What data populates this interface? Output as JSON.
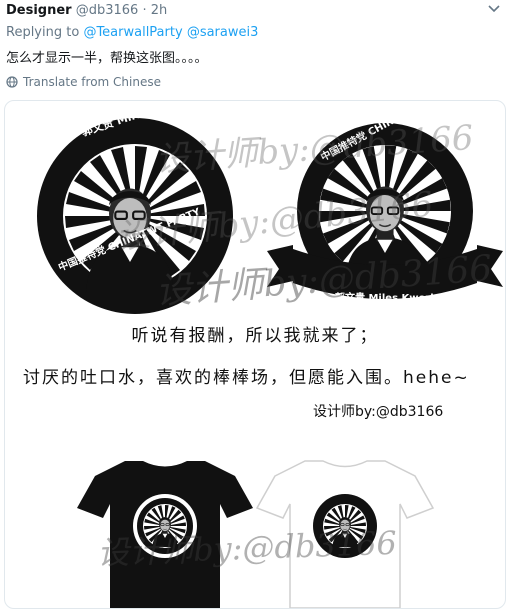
{
  "header": {
    "name": "Designer",
    "handle": "@db3166",
    "separator": "·",
    "time": "2h"
  },
  "reply": {
    "prefix": "Replying to",
    "mention1": "@TearwallParty",
    "mention2": "@sarawei3"
  },
  "body": "怎么才显示一半，帮换这张图。。。。",
  "translate_label": "Translate from Chinese",
  "image": {
    "logo_left_top_text": "郭文贵 Miles Kwork",
    "logo_left_bottom_text": "中国推特党 CHINATWT PARTY",
    "logo_right_top_text": "中国推特党 CHINATWT PARTY",
    "logo_right_ribbon_text": "郭文贵 Miles Kwork",
    "caption_line1": "听说有报酬，所以我就来了；",
    "caption_line2": "讨厌的吐口水，喜欢的棒棒场，但愿能入围。hehe~",
    "signature": "设计师by:@db3166",
    "watermark": "设计师by:@db3166",
    "shirt_logo_text": "中国推特党 CHINATWT PARTY"
  }
}
